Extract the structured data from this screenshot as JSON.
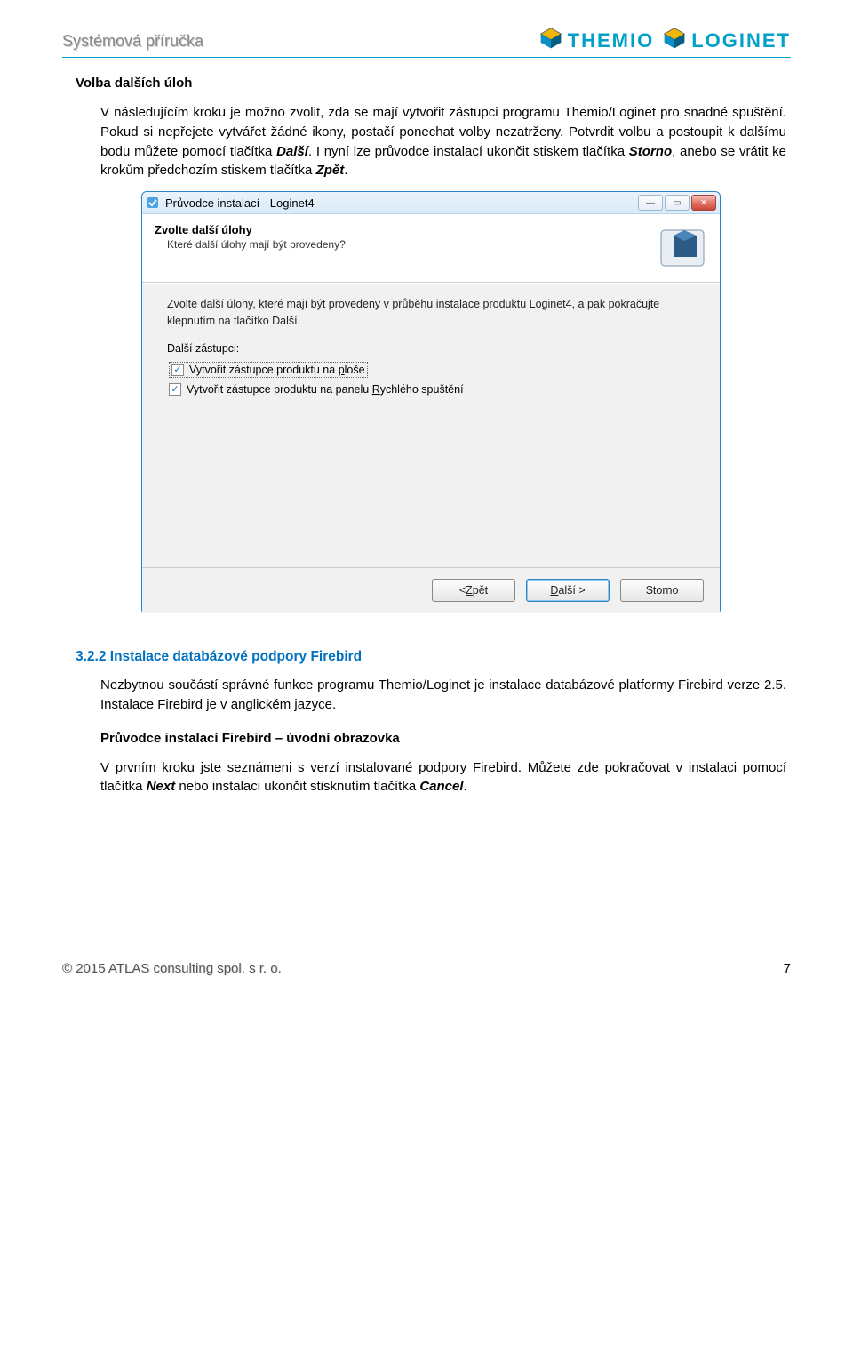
{
  "doc": {
    "header_title": "Systémová příručka",
    "logo1": "THEMIO",
    "logo2": "LOGINET"
  },
  "section1": {
    "heading": "Volba dalších úloh",
    "para": "V následujícím kroku je možno zvolit, zda se mají vytvořit zástupci programu Themio/Loginet pro snadné spuštění. Pokud si nepřejete vytvářet žádné ikony, postačí ponechat volby nezatrženy. Potvrdit volbu a postoupit k dalšímu bodu můžete pomocí tlačítka ",
    "it1": "Další",
    "para2": ". I nyní lze průvodce instalací ukončit stiskem tlačítka ",
    "it2": "Storno",
    "para3": ", anebo se vrátit ke krokům předchozím stiskem tlačítka ",
    "it3": "Zpět",
    "para4": "."
  },
  "installer": {
    "title": "Průvodce instalací - Loginet4",
    "panel_heading": "Zvolte další úlohy",
    "panel_sub": "Které další úlohy mají být provedeny?",
    "intro": "Zvolte další úlohy, které mají být provedeny v průběhu instalace produktu Loginet4, a pak pokračujte klepnutím na tlačítko Další.",
    "group_label": "Další zástupci:",
    "cb1_pre": "Vytvořit zástupce produktu na ",
    "cb1_u": "p",
    "cb1_post": "loše",
    "cb2_pre": "Vytvořit zástupce produktu na panelu ",
    "cb2_u": "R",
    "cb2_post": "ychlého spuštění",
    "btn_back_pre": "< ",
    "btn_back_u": "Z",
    "btn_back_post": "pět",
    "btn_next_u": "D",
    "btn_next_post": "alší >",
    "btn_cancel": "Storno"
  },
  "section2": {
    "heading": "3.2.2 Instalace databázové podpory Firebird",
    "para1": "Nezbytnou součástí správné funkce programu Themio/Loginet je instalace databázové platformy Firebird verze 2.5. Instalace Firebird je v anglickém jazyce.",
    "sub": "Průvodce instalací Firebird – úvodní obrazovka",
    "para2_a": "V prvním kroku jste seznámeni s verzí instalované podpory Firebird. Můžete zde pokračovat v instalaci pomocí tlačítka ",
    "it1": "Next",
    "para2_b": " nebo instalaci ukončit stisknutím tlačítka ",
    "it2": "Cancel",
    "para2_c": "."
  },
  "footer": {
    "copy": "© 2015  ATLAS consulting spol. s r. o.",
    "page": "7"
  }
}
